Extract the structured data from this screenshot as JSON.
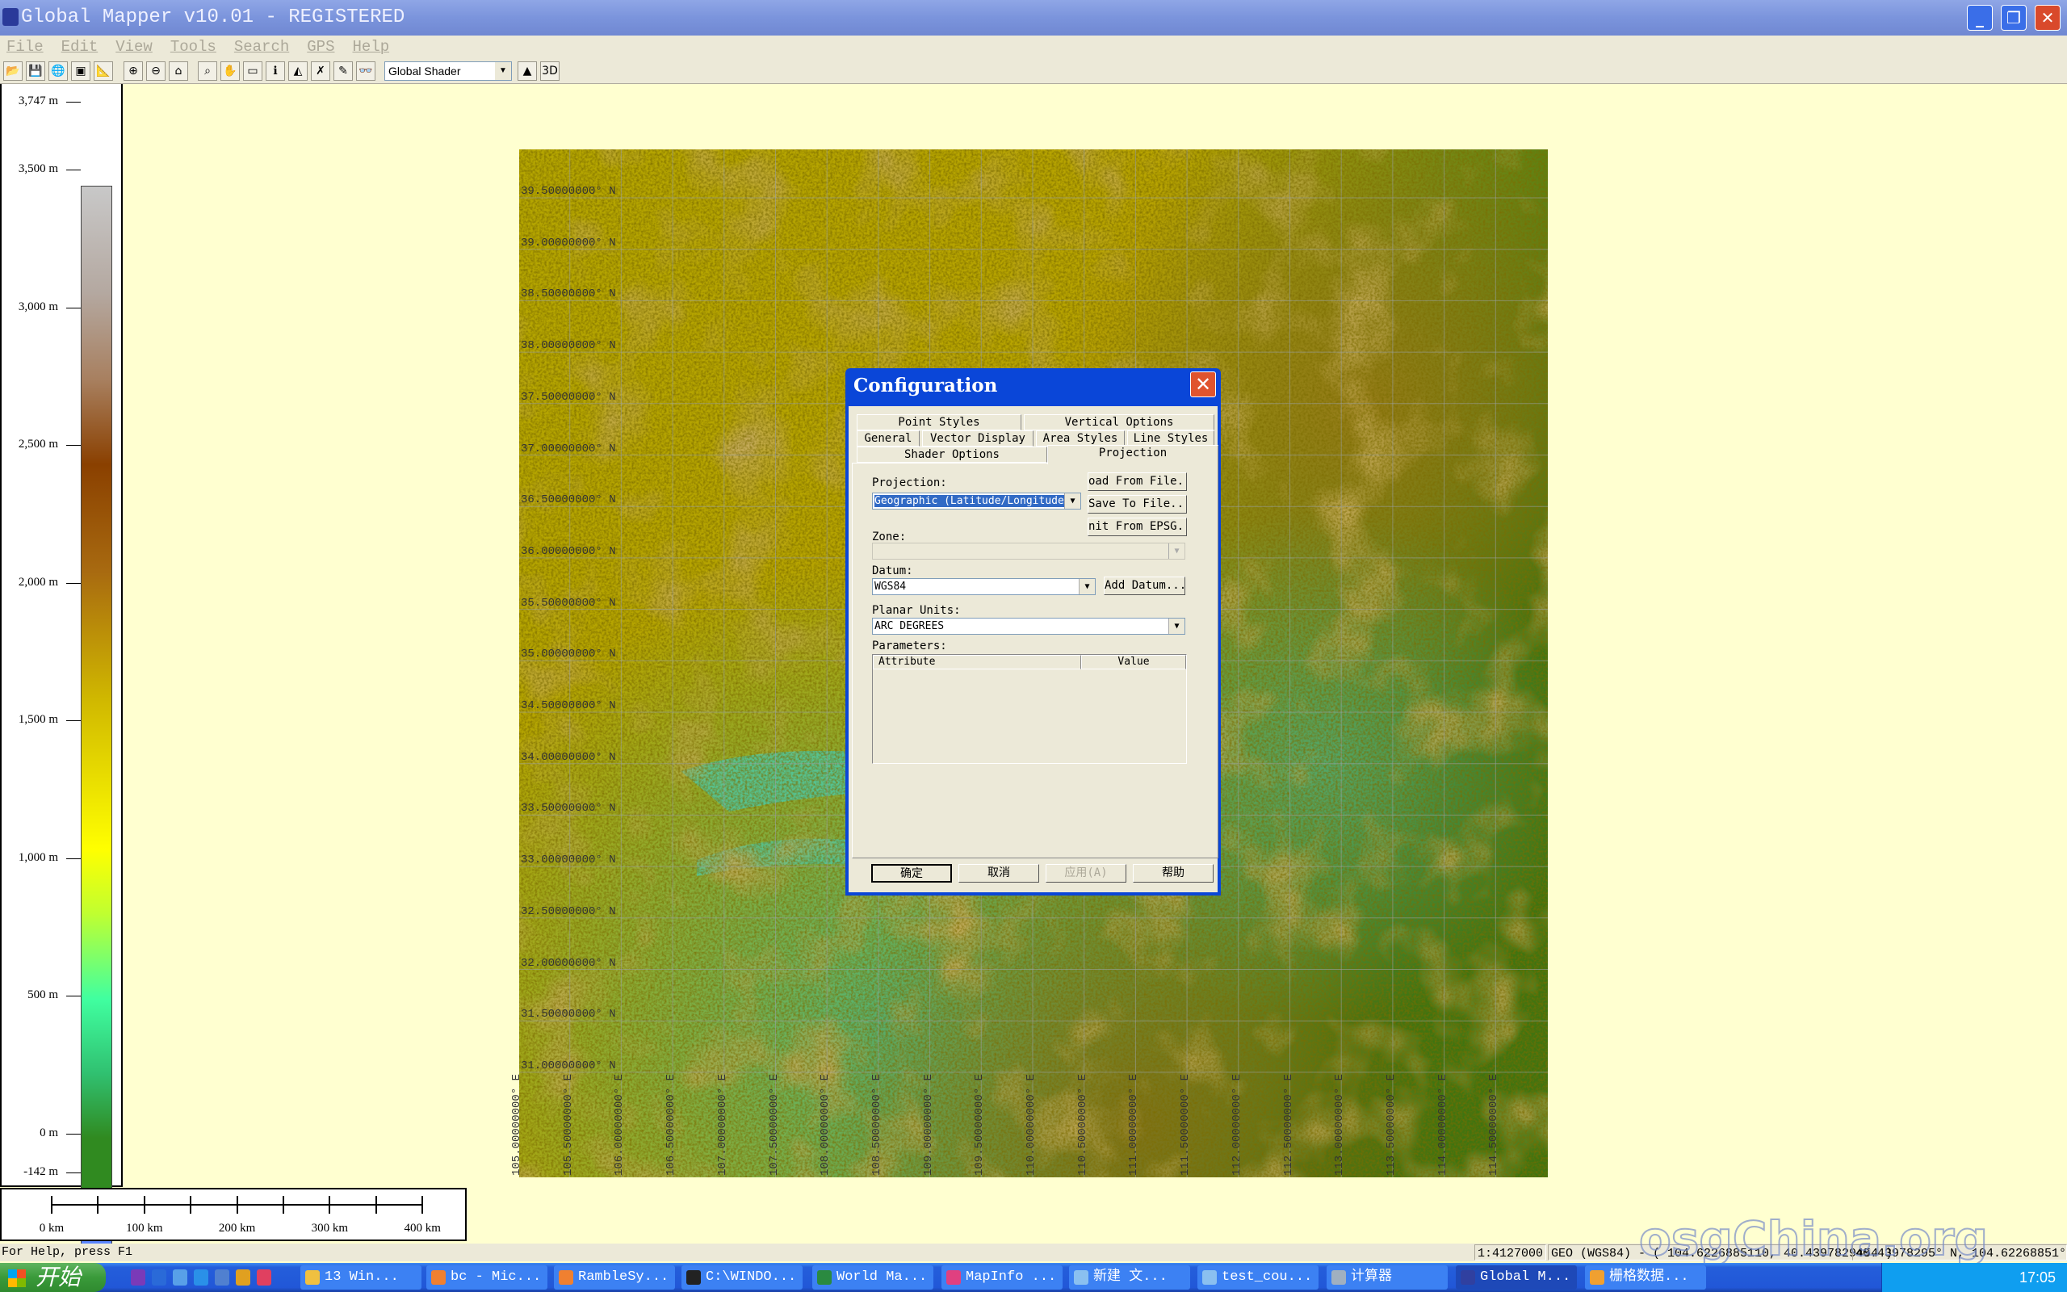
{
  "window": {
    "title": "Global Mapper v10.01 - REGISTERED",
    "min": "_",
    "max": "❐",
    "close": "✕"
  },
  "menu": [
    "File",
    "Edit",
    "View",
    "Tools",
    "Search",
    "GPS",
    "Help"
  ],
  "toolbar": {
    "shader_select": "Global Shader",
    "icons": [
      "open-icon",
      "save-icon",
      "globe-icon",
      "capture-icon",
      "digitizer-icon",
      "zoom-in-icon",
      "zoom-out-icon",
      "home-icon",
      "zoom-tool-icon",
      "pan-icon",
      "measure-icon",
      "info-icon",
      "path-profile-icon",
      "line-of-sight-icon",
      "digitize-icon",
      "search-icon",
      "2d-view-icon",
      "3d-view-icon"
    ],
    "glyphs": [
      "📂",
      "💾",
      "🌐",
      "▣",
      "📐",
      "⊕",
      "⊖",
      "⌂",
      "⌕",
      "✋",
      "▭",
      "ℹ",
      "◭",
      "✗",
      "✎",
      "👓",
      "▲",
      "3D"
    ]
  },
  "legend": {
    "labels": [
      "3,747 m",
      "3,500 m",
      "3,000 m",
      "2,500 m",
      "2,000 m",
      "1,500 m",
      "1,000 m",
      "500 m",
      "0 m",
      "-142 m"
    ],
    "values": [
      3747,
      3500,
      3000,
      2500,
      2000,
      1500,
      1000,
      500,
      0,
      -142
    ]
  },
  "map": {
    "lat_labels": [
      "39.50000000° N",
      "39.00000000° N",
      "38.50000000° N",
      "38.00000000° N",
      "37.50000000° N",
      "37.00000000° N",
      "36.50000000° N",
      "36.00000000° N",
      "35.50000000° N",
      "35.00000000° N",
      "34.50000000° N",
      "34.00000000° N",
      "33.50000000° N",
      "33.00000000° N",
      "32.50000000° N",
      "32.00000000° N",
      "31.50000000° N",
      "31.00000000° N"
    ],
    "lon_labels": [
      "105.00000000° E",
      "105.50000000° E",
      "106.00000000° E",
      "106.50000000° E",
      "107.00000000° E",
      "107.50000000° E",
      "108.00000000° E",
      "108.50000000° E",
      "109.00000000° E",
      "109.50000000° E",
      "110.00000000° E",
      "110.50000000° E",
      "111.00000000° E",
      "111.50000000° E",
      "112.00000000° E",
      "112.50000000° E",
      "113.00000000° E",
      "113.50000000° E",
      "114.00000000° E",
      "114.50000000° E"
    ]
  },
  "scale_bar": {
    "labels": [
      "0 km",
      "100 km",
      "200 km",
      "300 km",
      "400 km"
    ]
  },
  "status": {
    "help": "For Help, press F1",
    "scale": "1:4127000",
    "projection": "GEO (WGS84) - ( 104.6226885110, 40.4397829454 )",
    "coords": "40.43978295° N, 104.62268851° E"
  },
  "watermark": "osgChina.org",
  "dialog": {
    "title": "Configuration",
    "tabs_row1": [
      "Point Styles",
      "Vertical Options"
    ],
    "tabs_row2": [
      "General",
      "Vector Display",
      "Area Styles",
      "Line Styles"
    ],
    "tabs_row3": [
      "Shader Options",
      "Projection"
    ],
    "active_tab": "Projection",
    "projection_label": "Projection:",
    "projection_value": "Geographic (Latitude/Longitude)",
    "load_button": "oad From File..",
    "save_button": "Save To File...",
    "epsg_button": "nit From EPSG..",
    "zone_label": "Zone:",
    "zone_value": "",
    "datum_label": "Datum:",
    "datum_value": "WGS84",
    "add_datum_button": "Add Datum...",
    "units_label": "Planar Units:",
    "units_value": "ARC DEGREES",
    "params_label": "Parameters:",
    "col_attribute": "Attribute",
    "col_value": "Value",
    "ok": "确定",
    "cancel": "取消",
    "apply": "应用(A)",
    "help": "帮助"
  },
  "taskbar": {
    "start": "开始",
    "items": [
      "13 Win...",
      "bc - Mic...",
      "RambleSy...",
      "C:\\WINDO...",
      "World Ma...",
      "MapInfo ...",
      "新建 文...",
      "test_cou...",
      "计算器",
      "Global M...",
      "栅格数据..."
    ],
    "active": "Global M...",
    "clock": "17:05"
  }
}
